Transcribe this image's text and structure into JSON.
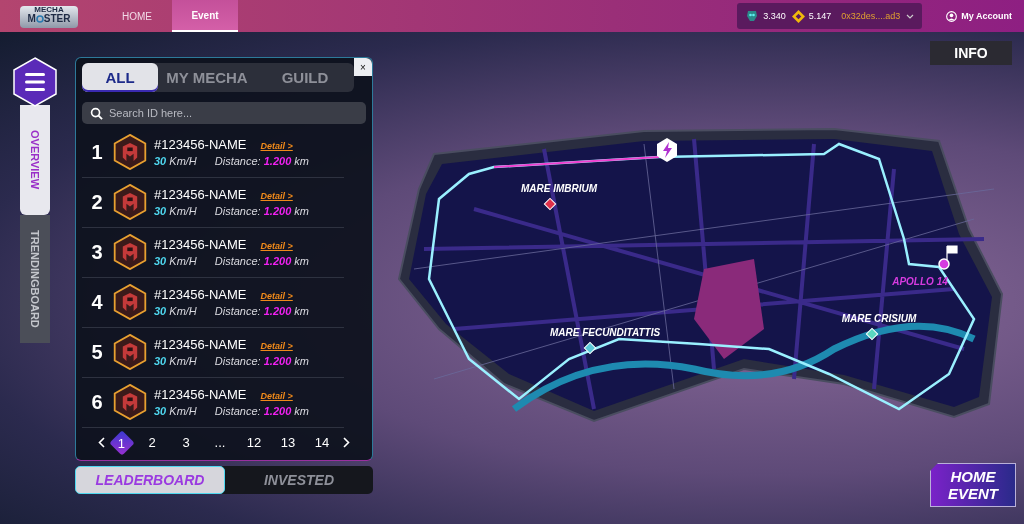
{
  "header": {
    "logo": {
      "top": "MECHA",
      "bottom_left": "M",
      "bottom_right": "STER"
    },
    "nav": [
      {
        "label": "HOME",
        "selected": false
      },
      {
        "label": "Event",
        "selected": true
      }
    ],
    "wallet": {
      "tokens": [
        {
          "kind": "robot",
          "amount": "3.340"
        },
        {
          "kind": "diamond",
          "amount": "5.147"
        }
      ],
      "address": "0x32des....ad3"
    },
    "account": "My Account"
  },
  "side_tabs": [
    {
      "label": "OVERVIEW",
      "selected": true
    },
    {
      "label": "TRENDINGBOARD",
      "selected": false
    }
  ],
  "panel": {
    "tabs": [
      {
        "label": "ALL",
        "selected": true
      },
      {
        "label": "MY MECHA",
        "selected": false
      },
      {
        "label": "GUILD",
        "selected": false
      }
    ],
    "close": "×",
    "search": {
      "placeholder": "Search ID here..."
    },
    "rows": [
      {
        "rank": "1",
        "name": "#123456-NAME",
        "detail": "Detail >",
        "speed": "30",
        "speed_unit": "Km/H",
        "distance_label": "Distance:",
        "distance": "1.200",
        "distance_unit": "km"
      },
      {
        "rank": "2",
        "name": "#123456-NAME",
        "detail": "Detail >",
        "speed": "30",
        "speed_unit": "Km/H",
        "distance_label": "Distance:",
        "distance": "1.200",
        "distance_unit": "km"
      },
      {
        "rank": "3",
        "name": "#123456-NAME",
        "detail": "Detail >",
        "speed": "30",
        "speed_unit": "Km/H",
        "distance_label": "Distance:",
        "distance": "1.200",
        "distance_unit": "km"
      },
      {
        "rank": "4",
        "name": "#123456-NAME",
        "detail": "Detail >",
        "speed": "30",
        "speed_unit": "Km/H",
        "distance_label": "Distance:",
        "distance": "1.200",
        "distance_unit": "km"
      },
      {
        "rank": "5",
        "name": "#123456-NAME",
        "detail": "Detail >",
        "speed": "30",
        "speed_unit": "Km/H",
        "distance_label": "Distance:",
        "distance": "1.200",
        "distance_unit": "km"
      },
      {
        "rank": "6",
        "name": "#123456-NAME",
        "detail": "Detail >",
        "speed": "30",
        "speed_unit": "Km/H",
        "distance_label": "Distance:",
        "distance": "1.200",
        "distance_unit": "km"
      }
    ],
    "pagination": [
      {
        "label": "1",
        "selected": true
      },
      {
        "label": "2",
        "selected": false
      },
      {
        "label": "3",
        "selected": false
      },
      {
        "label": "...",
        "selected": false
      },
      {
        "label": "12",
        "selected": false
      },
      {
        "label": "13",
        "selected": false
      },
      {
        "label": "14",
        "selected": false
      }
    ]
  },
  "bottom_tabs": [
    {
      "label": "LEADERBOARD",
      "selected": true
    },
    {
      "label": "INVESTED",
      "selected": false
    }
  ],
  "info_button": "INFO",
  "map": {
    "markers": [
      {
        "kind": "point",
        "label": "MARE IMBRIUM",
        "color": "#e0304a"
      },
      {
        "kind": "point",
        "label": "MARE FECUNDITATTIS",
        "color": "#5bc8d8"
      },
      {
        "kind": "point",
        "label": "MARE CRISIUM",
        "color": "#5bd8c0"
      },
      {
        "kind": "finish",
        "label": "APOLLO 14",
        "color": "#d63be0"
      }
    ]
  },
  "home_event": [
    "HOME",
    "EVENT"
  ]
}
